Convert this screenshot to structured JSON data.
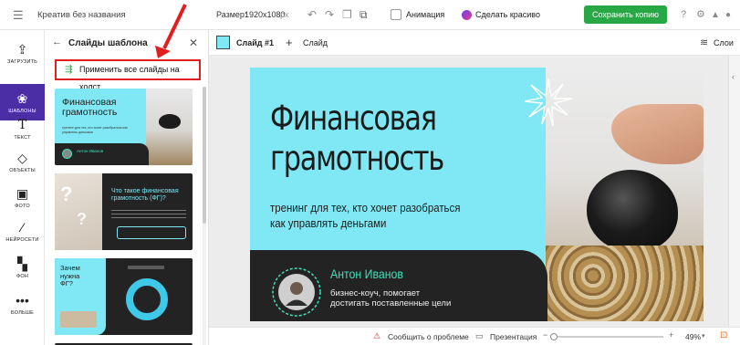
{
  "header": {
    "doc_title": "Креатив без названия",
    "size_label": "Размер:",
    "size_value": "1920x1080",
    "size_unit": "px",
    "animation_label": "Анимация",
    "beautify_label": "Сделать красиво",
    "save_copy_label": "Сохранить копию"
  },
  "rail": {
    "items": [
      {
        "label": "ЗАГРУЗИТЬ",
        "icon": "upload-icon"
      },
      {
        "label": "ШАБЛОНЫ",
        "icon": "templates-icon"
      },
      {
        "label": "ТЕКСТ",
        "icon": "text-icon"
      },
      {
        "label": "ОБЪЕКТЫ",
        "icon": "objects-icon"
      },
      {
        "label": "ФОТО",
        "icon": "photo-icon"
      },
      {
        "label": "НЕЙРОСЕТИ",
        "icon": "ai-wand-icon"
      },
      {
        "label": "ФОН",
        "icon": "background-icon"
      },
      {
        "label": "БОЛЬШЕ",
        "icon": "more-icon"
      }
    ]
  },
  "panel": {
    "title": "Слайды шаблона",
    "apply_all_label": "Применить все слайды на холст",
    "thumbs": [
      {
        "title": "Финансовая грамотность",
        "subtitle": "тренинг для тех, кто хочет разобраться как управлять деньгами",
        "name": "Антон Иванов"
      },
      {
        "title": "Что такое финансовая грамотность (ФГ)?"
      },
      {
        "title": "Зачем нужна ФГ?"
      }
    ]
  },
  "slidebar": {
    "slide_label": "Слайд #1",
    "add_label": "Слайд",
    "layers_label": "Слои"
  },
  "slide": {
    "title_line1": "Финансовая",
    "title_line2": "грамотность",
    "subtitle_line1": "тренинг для тех, кто хочет разобраться",
    "subtitle_line2": "как управлять деньгами",
    "author_name": "Антон Иванов",
    "author_role_line1": "бизнес-коуч, помогает",
    "author_role_line2": "достигать поставленные цели"
  },
  "footer": {
    "report_label": "Сообщить о проблеме",
    "presentation_label": "Презентация",
    "zoom_value": "49%"
  },
  "colors": {
    "accent_purple": "#4b2ea6",
    "save_green": "#28a745",
    "slide_cyan": "#7fe8f4",
    "slide_dark": "#232323",
    "highlight_red": "#e02020",
    "name_green": "#3fe0b8"
  }
}
